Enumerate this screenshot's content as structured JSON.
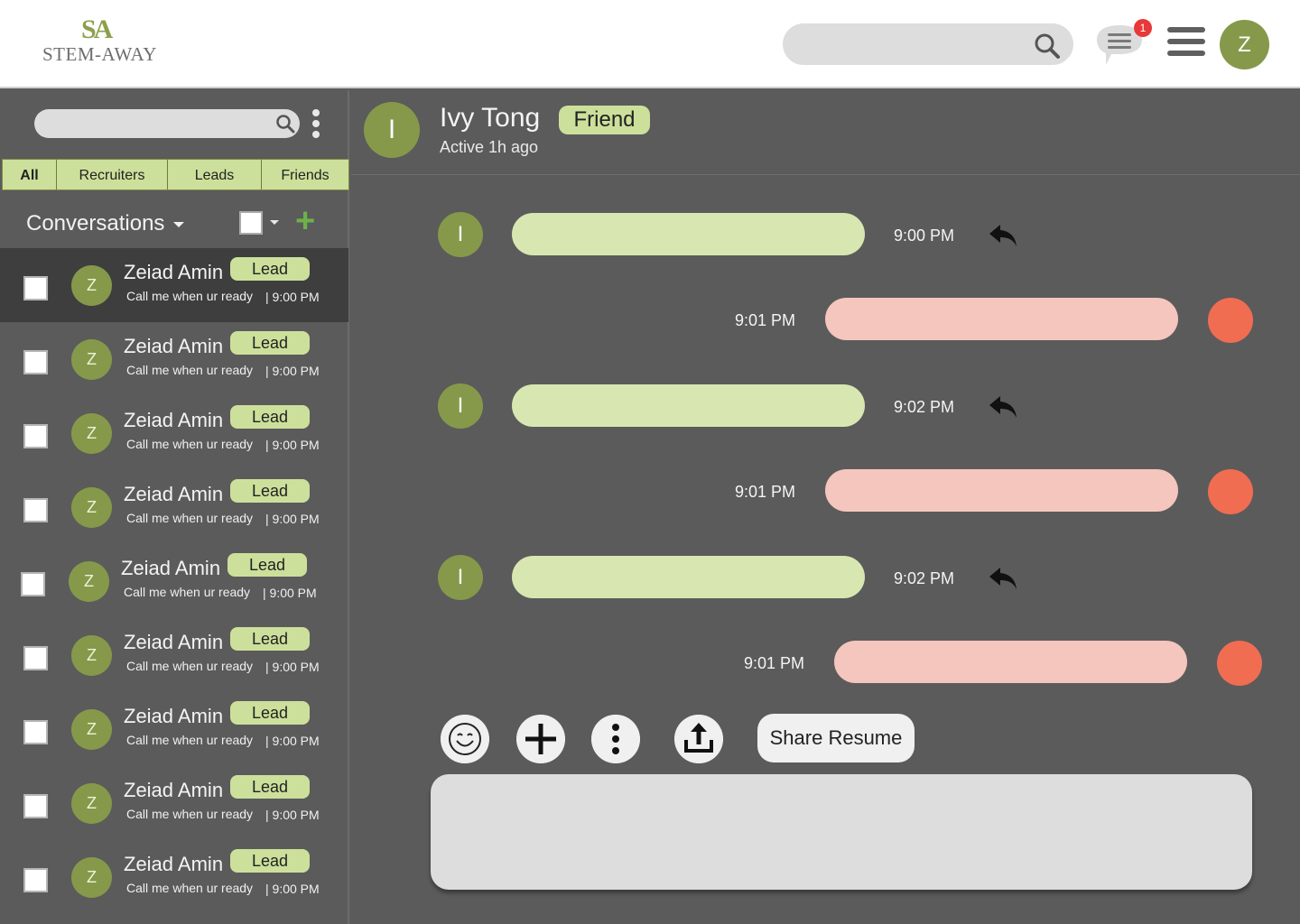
{
  "header": {
    "logo_mark": "SA",
    "logo_word": "STEM-AWAY",
    "search_placeholder": "",
    "notification_count": "1",
    "user_initial": "Z"
  },
  "sidebar": {
    "search_placeholder": "",
    "tabs": [
      {
        "label": "All",
        "active": true
      },
      {
        "label": "Recruiters",
        "active": false
      },
      {
        "label": "Leads",
        "active": false
      },
      {
        "label": "Friends",
        "active": false
      }
    ],
    "conversations_title": "Conversations",
    "conversations": [
      {
        "initial": "Z",
        "name": "Zeiad Amin",
        "badge": "Lead",
        "preview": "Call me when ur ready",
        "time": "| 9:00 PM",
        "selected": true
      },
      {
        "initial": "Z",
        "name": "Zeiad Amin",
        "badge": "Lead",
        "preview": "Call me when ur ready",
        "time": "| 9:00 PM"
      },
      {
        "initial": "Z",
        "name": "Zeiad Amin",
        "badge": "Lead",
        "preview": "Call me when ur ready",
        "time": "| 9:00 PM"
      },
      {
        "initial": "Z",
        "name": "Zeiad Amin",
        "badge": "Lead",
        "preview": "Call me when ur ready",
        "time": "| 9:00 PM"
      },
      {
        "initial": "Z",
        "name": "Zeiad Amin",
        "badge": "Lead",
        "preview": "Call me when ur ready",
        "time": "| 9:00 PM"
      },
      {
        "initial": "Z",
        "name": "Zeiad Amin",
        "badge": "Lead",
        "preview": "Call me when ur ready",
        "time": "| 9:00 PM"
      },
      {
        "initial": "Z",
        "name": "Zeiad Amin",
        "badge": "Lead",
        "preview": "Call me when ur ready",
        "time": "| 9:00 PM"
      },
      {
        "initial": "Z",
        "name": "Zeiad Amin",
        "badge": "Lead",
        "preview": "Call me when ur ready",
        "time": "| 9:00 PM"
      },
      {
        "initial": "Z",
        "name": "Zeiad Amin",
        "badge": "Lead",
        "preview": "Call me when ur ready",
        "time": "| 9:00 PM"
      }
    ]
  },
  "chat": {
    "contact_initial": "I",
    "contact_name": "Ivy Tong",
    "contact_badge": "Friend",
    "status": "Active 1h ago",
    "messages": [
      {
        "direction": "in",
        "initial": "I",
        "time": "9:00 PM"
      },
      {
        "direction": "out",
        "time": "9:01 PM"
      },
      {
        "direction": "in",
        "initial": "I",
        "time": "9:02 PM"
      },
      {
        "direction": "out",
        "time": "9:01 PM"
      },
      {
        "direction": "in",
        "initial": "I",
        "time": "9:02 PM"
      },
      {
        "direction": "out",
        "time": "9:01 PM"
      }
    ],
    "share_resume_label": "Share Resume",
    "composer_placeholder": ""
  },
  "colors": {
    "accent_green": "#86994a",
    "badge_green": "#cde09b",
    "incoming_bubble": "#d8e7b2",
    "outgoing_bubble": "#f5c6bd",
    "outgoing_avatar": "#f06d52",
    "background": "#5b5b5b",
    "notification_red": "#e8383a"
  }
}
